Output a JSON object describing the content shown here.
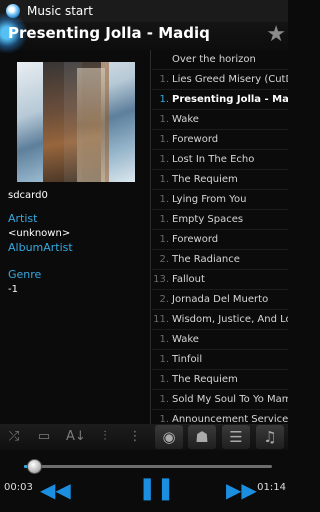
{
  "app": {
    "title": "Music start",
    "icon": "music-app-icon"
  },
  "now_playing": {
    "title": "Presenting Jolla - Madiq",
    "favorite_icon": "star-icon"
  },
  "track_info": {
    "storage": "sdcard0",
    "artist_label": "Artist",
    "artist_value": "<unknown>",
    "album_artist_label": "AlbumArtist",
    "genre_label": "Genre",
    "genre_value": "-1"
  },
  "playlist": {
    "current_index": 2,
    "items": [
      {
        "num": "",
        "title": "Over the horizon"
      },
      {
        "num": "1.",
        "title": "Lies Greed Misery (CutDub"
      },
      {
        "num": "1.",
        "title": "Presenting Jolla - Madiq"
      },
      {
        "num": "1.",
        "title": "Wake"
      },
      {
        "num": "1.",
        "title": "Foreword"
      },
      {
        "num": "1.",
        "title": "Lost In The Echo"
      },
      {
        "num": "1.",
        "title": "The Requiem"
      },
      {
        "num": "1.",
        "title": "Lying From You"
      },
      {
        "num": "1.",
        "title": "Empty Spaces"
      },
      {
        "num": "1.",
        "title": "Foreword"
      },
      {
        "num": "2.",
        "title": "The Radiance"
      },
      {
        "num": "13.",
        "title": "Fallout"
      },
      {
        "num": "2.",
        "title": "Jornada Del Muerto"
      },
      {
        "num": "11.",
        "title": "Wisdom, Justice, And Love"
      },
      {
        "num": "1.",
        "title": "Wake"
      },
      {
        "num": "1.",
        "title": "Tinfoil"
      },
      {
        "num": "1.",
        "title": "The Requiem"
      },
      {
        "num": "1.",
        "title": "Sold My Soul To Yo Mama"
      },
      {
        "num": "1.",
        "title": "Announcement Service Pu"
      }
    ]
  },
  "toolbar": {
    "icons": [
      "shuffle-icon",
      "repeat-icon",
      "sort-az-icon",
      "equalizer-icon",
      "overflow-menu-icon",
      "disc-icon",
      "artist-icon",
      "playlist-icon",
      "music-note-icon"
    ]
  },
  "playback": {
    "elapsed": "00:03",
    "duration": "01:14",
    "progress": 0.04,
    "accent": "#36a9e1"
  }
}
